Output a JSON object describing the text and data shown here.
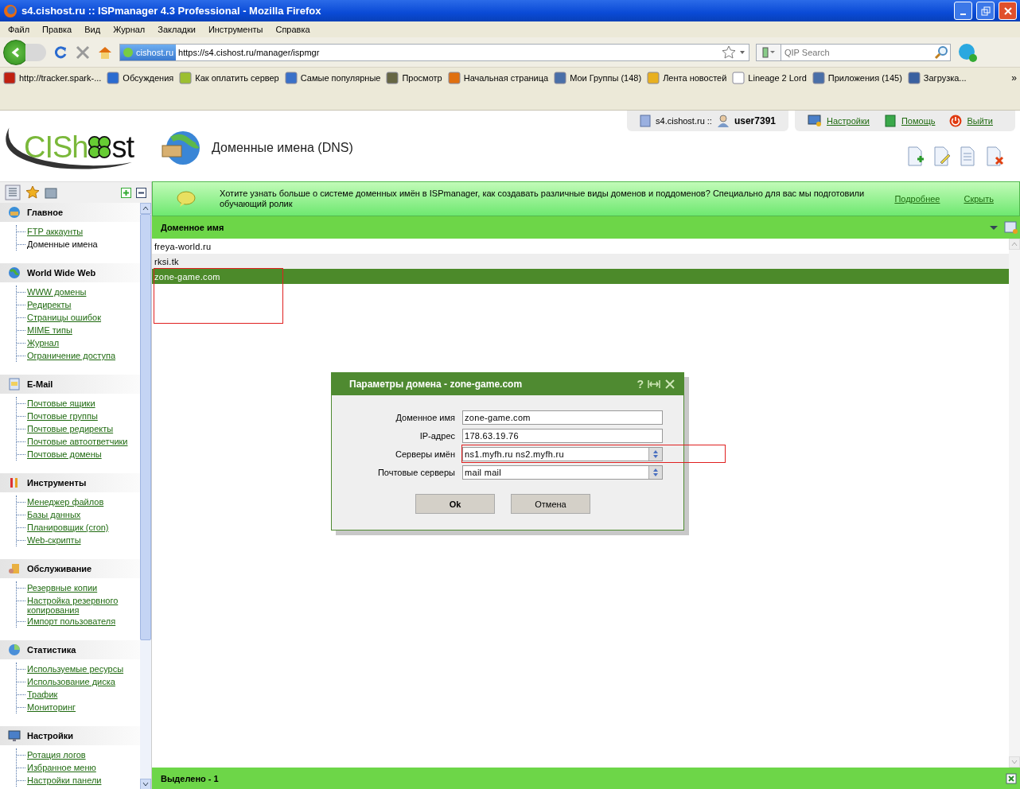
{
  "window": {
    "title": "s4.cishost.ru :: ISPmanager 4.3 Professional - Mozilla Firefox"
  },
  "menu": [
    "Файл",
    "Правка",
    "Вид",
    "Журнал",
    "Закладки",
    "Инструменты",
    "Справка"
  ],
  "navigation": {
    "site_badge": "cishost.ru",
    "url": "https://s4.cishost.ru/manager/ispmgr",
    "search_placeholder": "QIP Search"
  },
  "bookmarks": [
    "http://tracker.spark-...",
    "Обсуждения",
    "Как оплатить сервер",
    "Самые популярные",
    "Просмотр",
    "Начальная страница",
    "Мои Группы (148)",
    "Лента новостей",
    "Lineage 2 Lord",
    "Приложения (145)",
    "Загрузка..."
  ],
  "bookmarks_more": "»",
  "header": {
    "server": "s4.cishost.ru ::",
    "user": "user7391",
    "links": [
      "Настройки",
      "Помощь",
      "Выйти"
    ],
    "logo_left": "CISh",
    "logo_right": "st",
    "page_title": "Доменные имена (DNS)"
  },
  "banner": {
    "text": "Хотите узнать больше о системе доменных имён в ISPmanager, как создавать различные виды доменов и поддоменов? Специально для вас мы подготовили обучающий ролик",
    "links": [
      "Подробнее",
      "Скрыть"
    ]
  },
  "sidebar": {
    "groups": [
      {
        "title": "Главное",
        "items": [
          {
            "label": "FTP аккаунты",
            "selected": false
          },
          {
            "label": "Доменные имена",
            "selected": true
          }
        ]
      },
      {
        "title": "World Wide Web",
        "items": [
          {
            "label": "WWW домены",
            "selected": false
          },
          {
            "label": "Редиректы",
            "selected": false
          },
          {
            "label": "Страницы ошибок",
            "selected": false
          },
          {
            "label": "MIME типы",
            "selected": false
          },
          {
            "label": "Журнал",
            "selected": false
          },
          {
            "label": "Ограничение доступа",
            "selected": false
          }
        ]
      },
      {
        "title": "E-Mail",
        "items": [
          {
            "label": "Почтовые ящики",
            "selected": false
          },
          {
            "label": "Почтовые группы",
            "selected": false
          },
          {
            "label": "Почтовые редиректы",
            "selected": false
          },
          {
            "label": "Почтовые автоответчики",
            "selected": false
          },
          {
            "label": "Почтовые домены",
            "selected": false
          }
        ]
      },
      {
        "title": "Инструменты",
        "items": [
          {
            "label": "Менеджер файлов",
            "selected": false
          },
          {
            "label": "Базы данных",
            "selected": false
          },
          {
            "label": "Планировщик (cron)",
            "selected": false
          },
          {
            "label": "Web-скрипты",
            "selected": false
          }
        ]
      },
      {
        "title": "Обслуживание",
        "items": [
          {
            "label": "Резервные копии",
            "selected": false
          },
          {
            "label": "Настройка резервного копирования",
            "selected": false
          },
          {
            "label": "Импорт пользователя",
            "selected": false
          }
        ]
      },
      {
        "title": "Статистика",
        "items": [
          {
            "label": "Используемые ресурсы",
            "selected": false
          },
          {
            "label": "Использование диска",
            "selected": false
          },
          {
            "label": "Трафик",
            "selected": false
          },
          {
            "label": "Мониторинг",
            "selected": false
          }
        ]
      },
      {
        "title": "Настройки",
        "items": [
          {
            "label": "Ротация логов",
            "selected": false
          },
          {
            "label": "Избранное меню",
            "selected": false
          },
          {
            "label": "Настройки панели",
            "selected": false
          }
        ]
      }
    ]
  },
  "table": {
    "columns": [
      "Доменное имя"
    ],
    "rows": [
      {
        "cells": [
          "freya-world.ru"
        ],
        "selected": false
      },
      {
        "cells": [
          "rksi.tk"
        ],
        "selected": false
      },
      {
        "cells": [
          "zone-game.com"
        ],
        "selected": true
      }
    ]
  },
  "status_bar": "Выделено - 1",
  "dialog": {
    "title": "Параметры домена - zone-game.com",
    "help_glyph": "?",
    "fields": [
      {
        "label": "Доменное имя",
        "value": "zone-game.com",
        "kind": "text"
      },
      {
        "label": "IP-адрес",
        "value": "178.63.19.76",
        "kind": "text"
      },
      {
        "label": "Серверы имён",
        "value": "ns1.myfh.ru ns2.myfh.ru",
        "kind": "list"
      },
      {
        "label": "Почтовые серверы",
        "value": "mail mail",
        "kind": "list"
      }
    ],
    "buttons": [
      {
        "label": "Ok",
        "kind": "primary"
      },
      {
        "label": "Отмена",
        "kind": "secondary"
      }
    ]
  }
}
